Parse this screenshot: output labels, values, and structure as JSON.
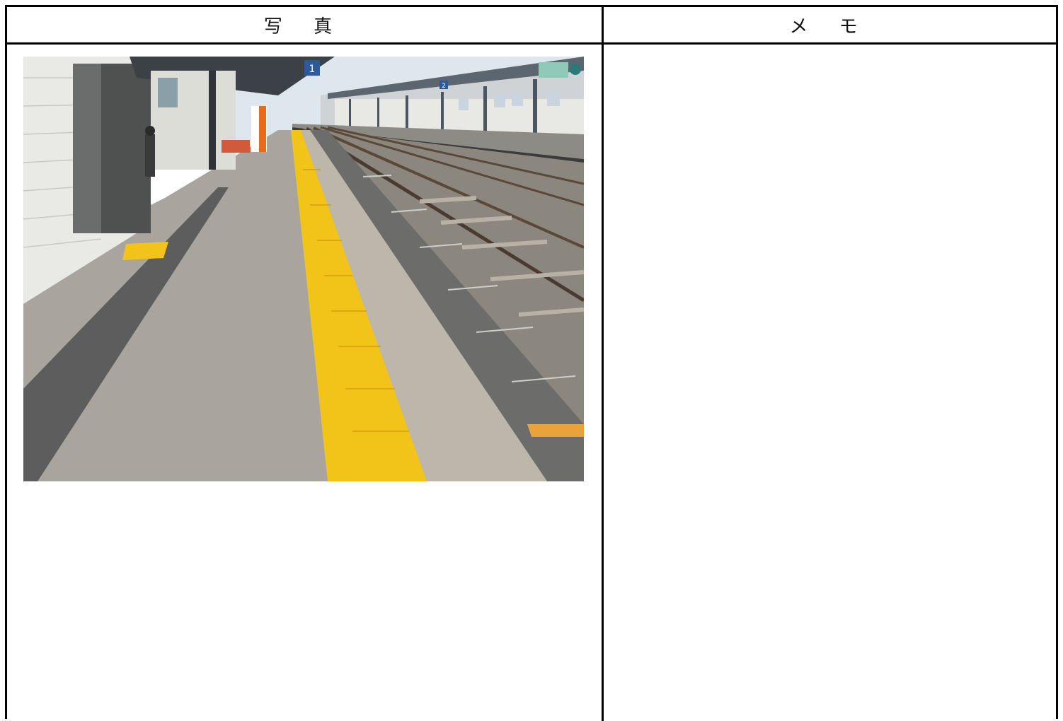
{
  "table": {
    "photo_header": "写 真",
    "memo_header": "メ モ",
    "memo_text": ""
  },
  "photo": {
    "subject": "train-station-platform",
    "platform_sign_number": "1",
    "platform_sign_number_far": "2"
  },
  "colors": {
    "tactile_paving": "#f2c41a",
    "platform_concrete": "#a9a59e",
    "border": "#000000"
  }
}
